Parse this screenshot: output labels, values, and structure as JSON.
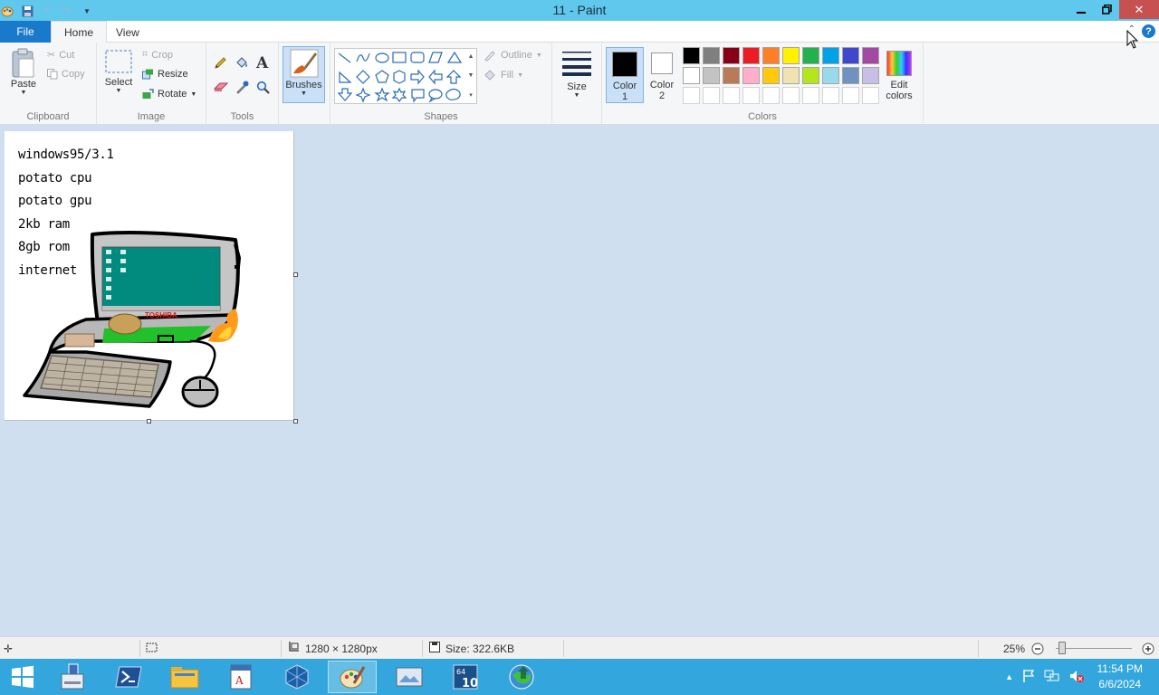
{
  "window": {
    "title": "11 - Paint"
  },
  "tabs": {
    "file": "File",
    "home": "Home",
    "view": "View",
    "help": "?"
  },
  "clipboard": {
    "paste": "Paste",
    "cut": "Cut",
    "copy": "Copy",
    "label": "Clipboard"
  },
  "image": {
    "select": "Select",
    "crop": "Crop",
    "resize": "Resize",
    "rotate": "Rotate",
    "label": "Image"
  },
  "tools": {
    "label": "Tools",
    "text_tool": "A"
  },
  "brushes": {
    "label": "Brushes"
  },
  "shapes": {
    "outline": "Outline",
    "fill": "Fill",
    "label": "Shapes"
  },
  "size": {
    "label": "Size"
  },
  "colors": {
    "color1_line1": "Color",
    "color1_line2": "1",
    "color2_line1": "Color",
    "color2_line2": "2",
    "edit_line1": "Edit",
    "edit_line2": "colors",
    "label": "Colors",
    "color1_value": "#000000",
    "color2_value": "#ffffff",
    "palette_row1": [
      "#000000",
      "#7f7f7f",
      "#880015",
      "#ed1c24",
      "#ff7f27",
      "#fff200",
      "#22b14c",
      "#00a2e8",
      "#3f48cc",
      "#a349a4"
    ],
    "palette_row2": [
      "#ffffff",
      "#c3c3c3",
      "#b97a57",
      "#ffaec9",
      "#ffc90e",
      "#efe4b0",
      "#b5e61d",
      "#99d9ea",
      "#7092be",
      "#c8bfe7"
    ]
  },
  "canvas": {
    "specs": [
      "windows95/3.1",
      "potato cpu",
      "potato gpu",
      "2kb ram",
      "8gb rom",
      "internet"
    ],
    "laptop_brand": "TOSHIBA"
  },
  "status": {
    "dimensions": "1280 × 1280px",
    "size": "Size: 322.6KB",
    "zoom": "25%"
  },
  "taskbar": {
    "time": "11:54 PM",
    "date": "6/6/2024"
  }
}
